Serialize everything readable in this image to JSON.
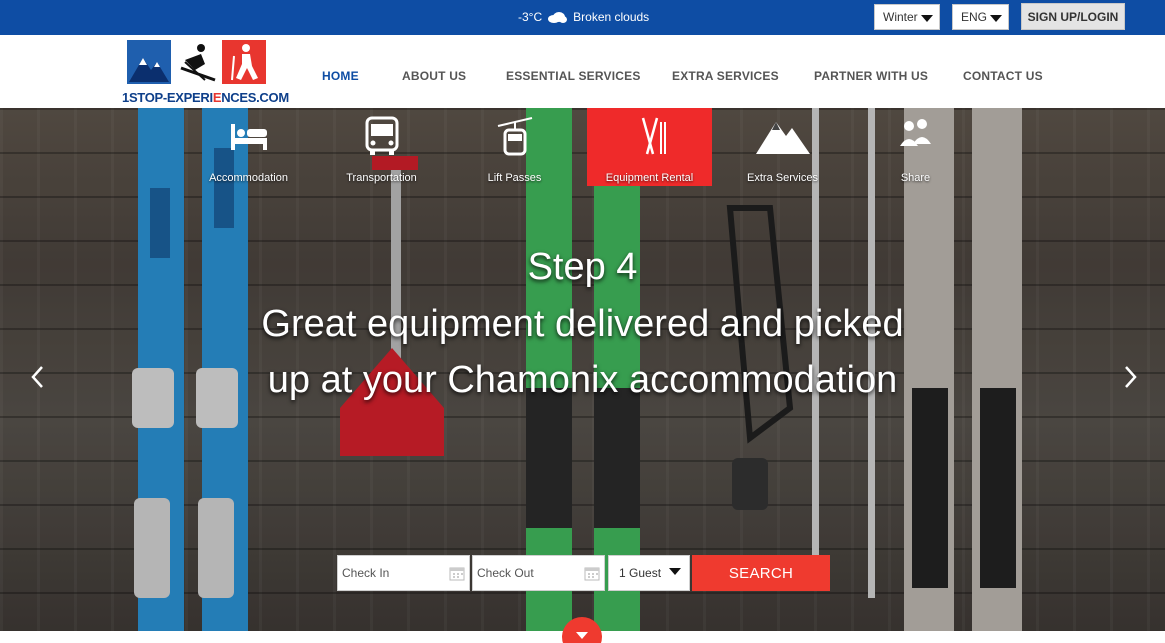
{
  "topbar": {
    "weather": {
      "temperature": "-3°C",
      "condition": "Broken clouds",
      "icon": "cloud-icon"
    },
    "season_select": {
      "value": "Winter"
    },
    "language_select": {
      "value": "ENG"
    },
    "signup_label": "SIGN UP/LOGIN"
  },
  "brand": {
    "logo_text_prefix": "1",
    "logo_text_main": "STOP-EXPERI",
    "logo_text_red": "E",
    "logo_text_rest": "NCES.COM"
  },
  "nav": {
    "items": [
      {
        "label": "HOME",
        "active": true
      },
      {
        "label": "ABOUT US"
      },
      {
        "label": "ESSENTIAL SERVICES"
      },
      {
        "label": "EXTRA SERVICES"
      },
      {
        "label": "PARTNER WITH US"
      },
      {
        "label": "CONTACT US"
      }
    ]
  },
  "services": {
    "items": [
      {
        "label": "Accommodation",
        "icon": "bed-icon"
      },
      {
        "label": "Transportation",
        "icon": "bus-icon"
      },
      {
        "label": "Lift Passes",
        "icon": "gondola-icon"
      },
      {
        "label": "Equipment Rental",
        "icon": "skis-icon",
        "active": true
      },
      {
        "label": "Extra Services",
        "icon": "mountain-icon"
      },
      {
        "label": "Share",
        "icon": "people-icon"
      }
    ]
  },
  "hero": {
    "step": "Step 4",
    "headline_line1": "Great equipment delivered and picked",
    "headline_line2": "up at your Chamonix accommodation"
  },
  "booking": {
    "check_in_placeholder": "Check In",
    "check_out_placeholder": "Check Out",
    "guests_value": "1 Guest",
    "search_label": "SEARCH"
  },
  "colors": {
    "primary_blue": "#0e4da4",
    "accent_red": "#ef3a2f"
  }
}
